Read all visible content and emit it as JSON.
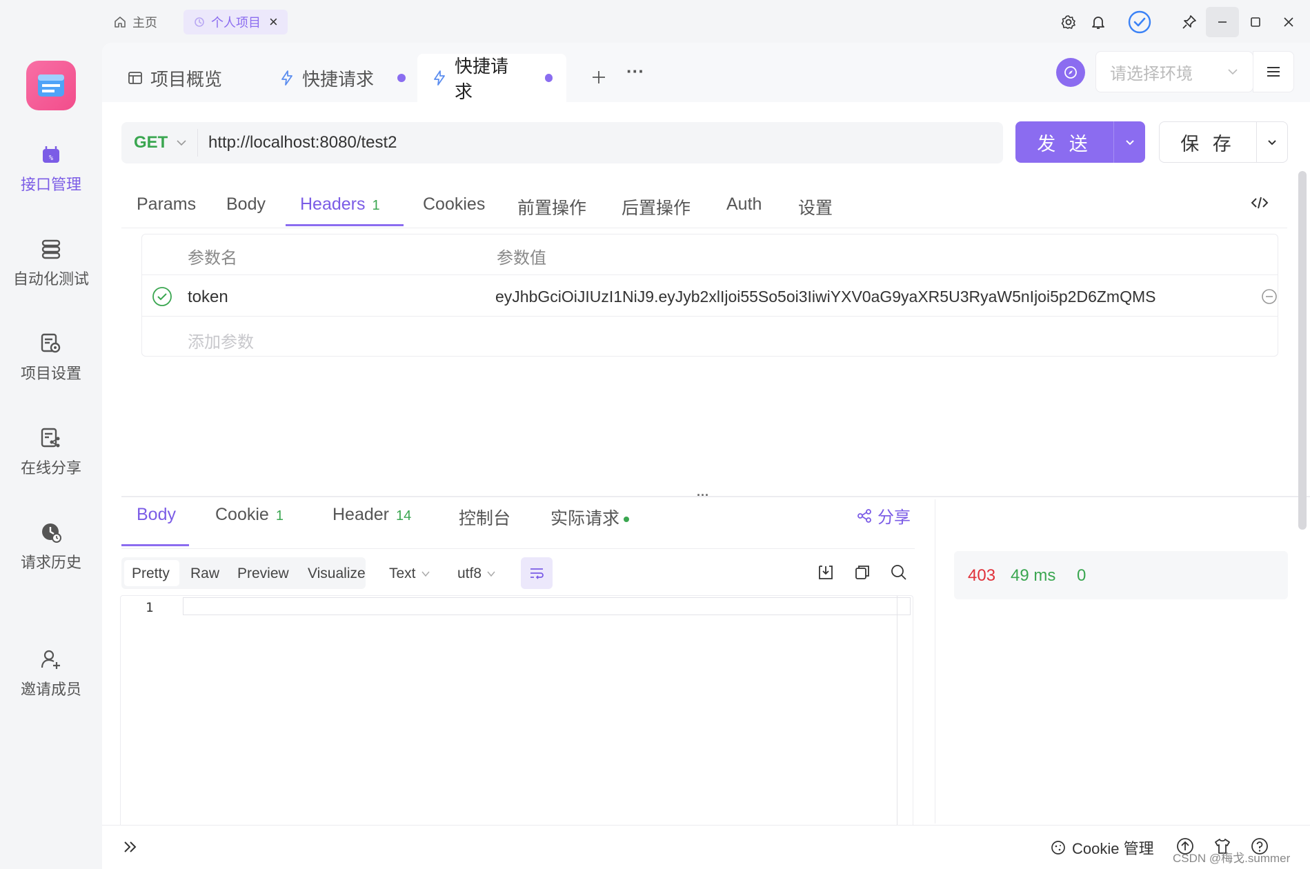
{
  "titlebar": {
    "home_label": "主页",
    "project_tab_label": "个人项目",
    "close_glyph": "×"
  },
  "sidebar": {
    "items": [
      {
        "label": "接口管理",
        "icon": "api-manage-icon",
        "active": true
      },
      {
        "label": "自动化测试",
        "icon": "automation-test-icon",
        "active": false
      },
      {
        "label": "项目设置",
        "icon": "project-settings-icon",
        "active": false
      },
      {
        "label": "在线分享",
        "icon": "online-share-icon",
        "active": false
      },
      {
        "label": "请求历史",
        "icon": "request-history-icon",
        "active": false
      },
      {
        "label": "邀请成员",
        "icon": "invite-member-icon",
        "active": false
      }
    ]
  },
  "tabs": {
    "overview": "项目概览",
    "quick1": "快捷请求",
    "quick2": "快捷请求",
    "more": "···"
  },
  "env": {
    "placeholder": "请选择环境"
  },
  "request": {
    "method": "GET",
    "url": "http://localhost:8080/test2",
    "send_label": "发 送",
    "save_label": "保 存"
  },
  "req_tabs": {
    "params": "Params",
    "body": "Body",
    "headers": "Headers",
    "headers_count": "1",
    "cookies": "Cookies",
    "pre": "前置操作",
    "post": "后置操作",
    "auth": "Auth",
    "settings": "设置"
  },
  "headers_table": {
    "col_name": "参数名",
    "col_value": "参数值",
    "rows": [
      {
        "name": "token",
        "value": "eyJhbGciOiJIUzI1NiJ9.eyJyb2xlIjoi55So5oi3IiwiYXV0aG9yaXR5U3RyaW5nIjoi5p2D6ZmQMS"
      }
    ],
    "add_placeholder": "添加参数"
  },
  "response": {
    "tabs": {
      "body": "Body",
      "cookie": "Cookie",
      "cookie_count": "1",
      "header": "Header",
      "header_count": "14",
      "console": "控制台",
      "actual": "实际请求"
    },
    "share_label": "分享",
    "formats": {
      "pretty": "Pretty",
      "raw": "Raw",
      "preview": "Preview",
      "visualize": "Visualize",
      "text": "Text",
      "encoding": "utf8"
    },
    "line_number": "1",
    "status_code": "403",
    "time": "49 ms",
    "size": "0"
  },
  "footer": {
    "cookie_manage": "Cookie 管理"
  },
  "watermark": "CSDN @梅戈.summer",
  "colors": {
    "accent": "#8b6cf0",
    "method_get": "#3aa650",
    "status_error": "#e0313a",
    "status_ok": "#3aa650"
  }
}
